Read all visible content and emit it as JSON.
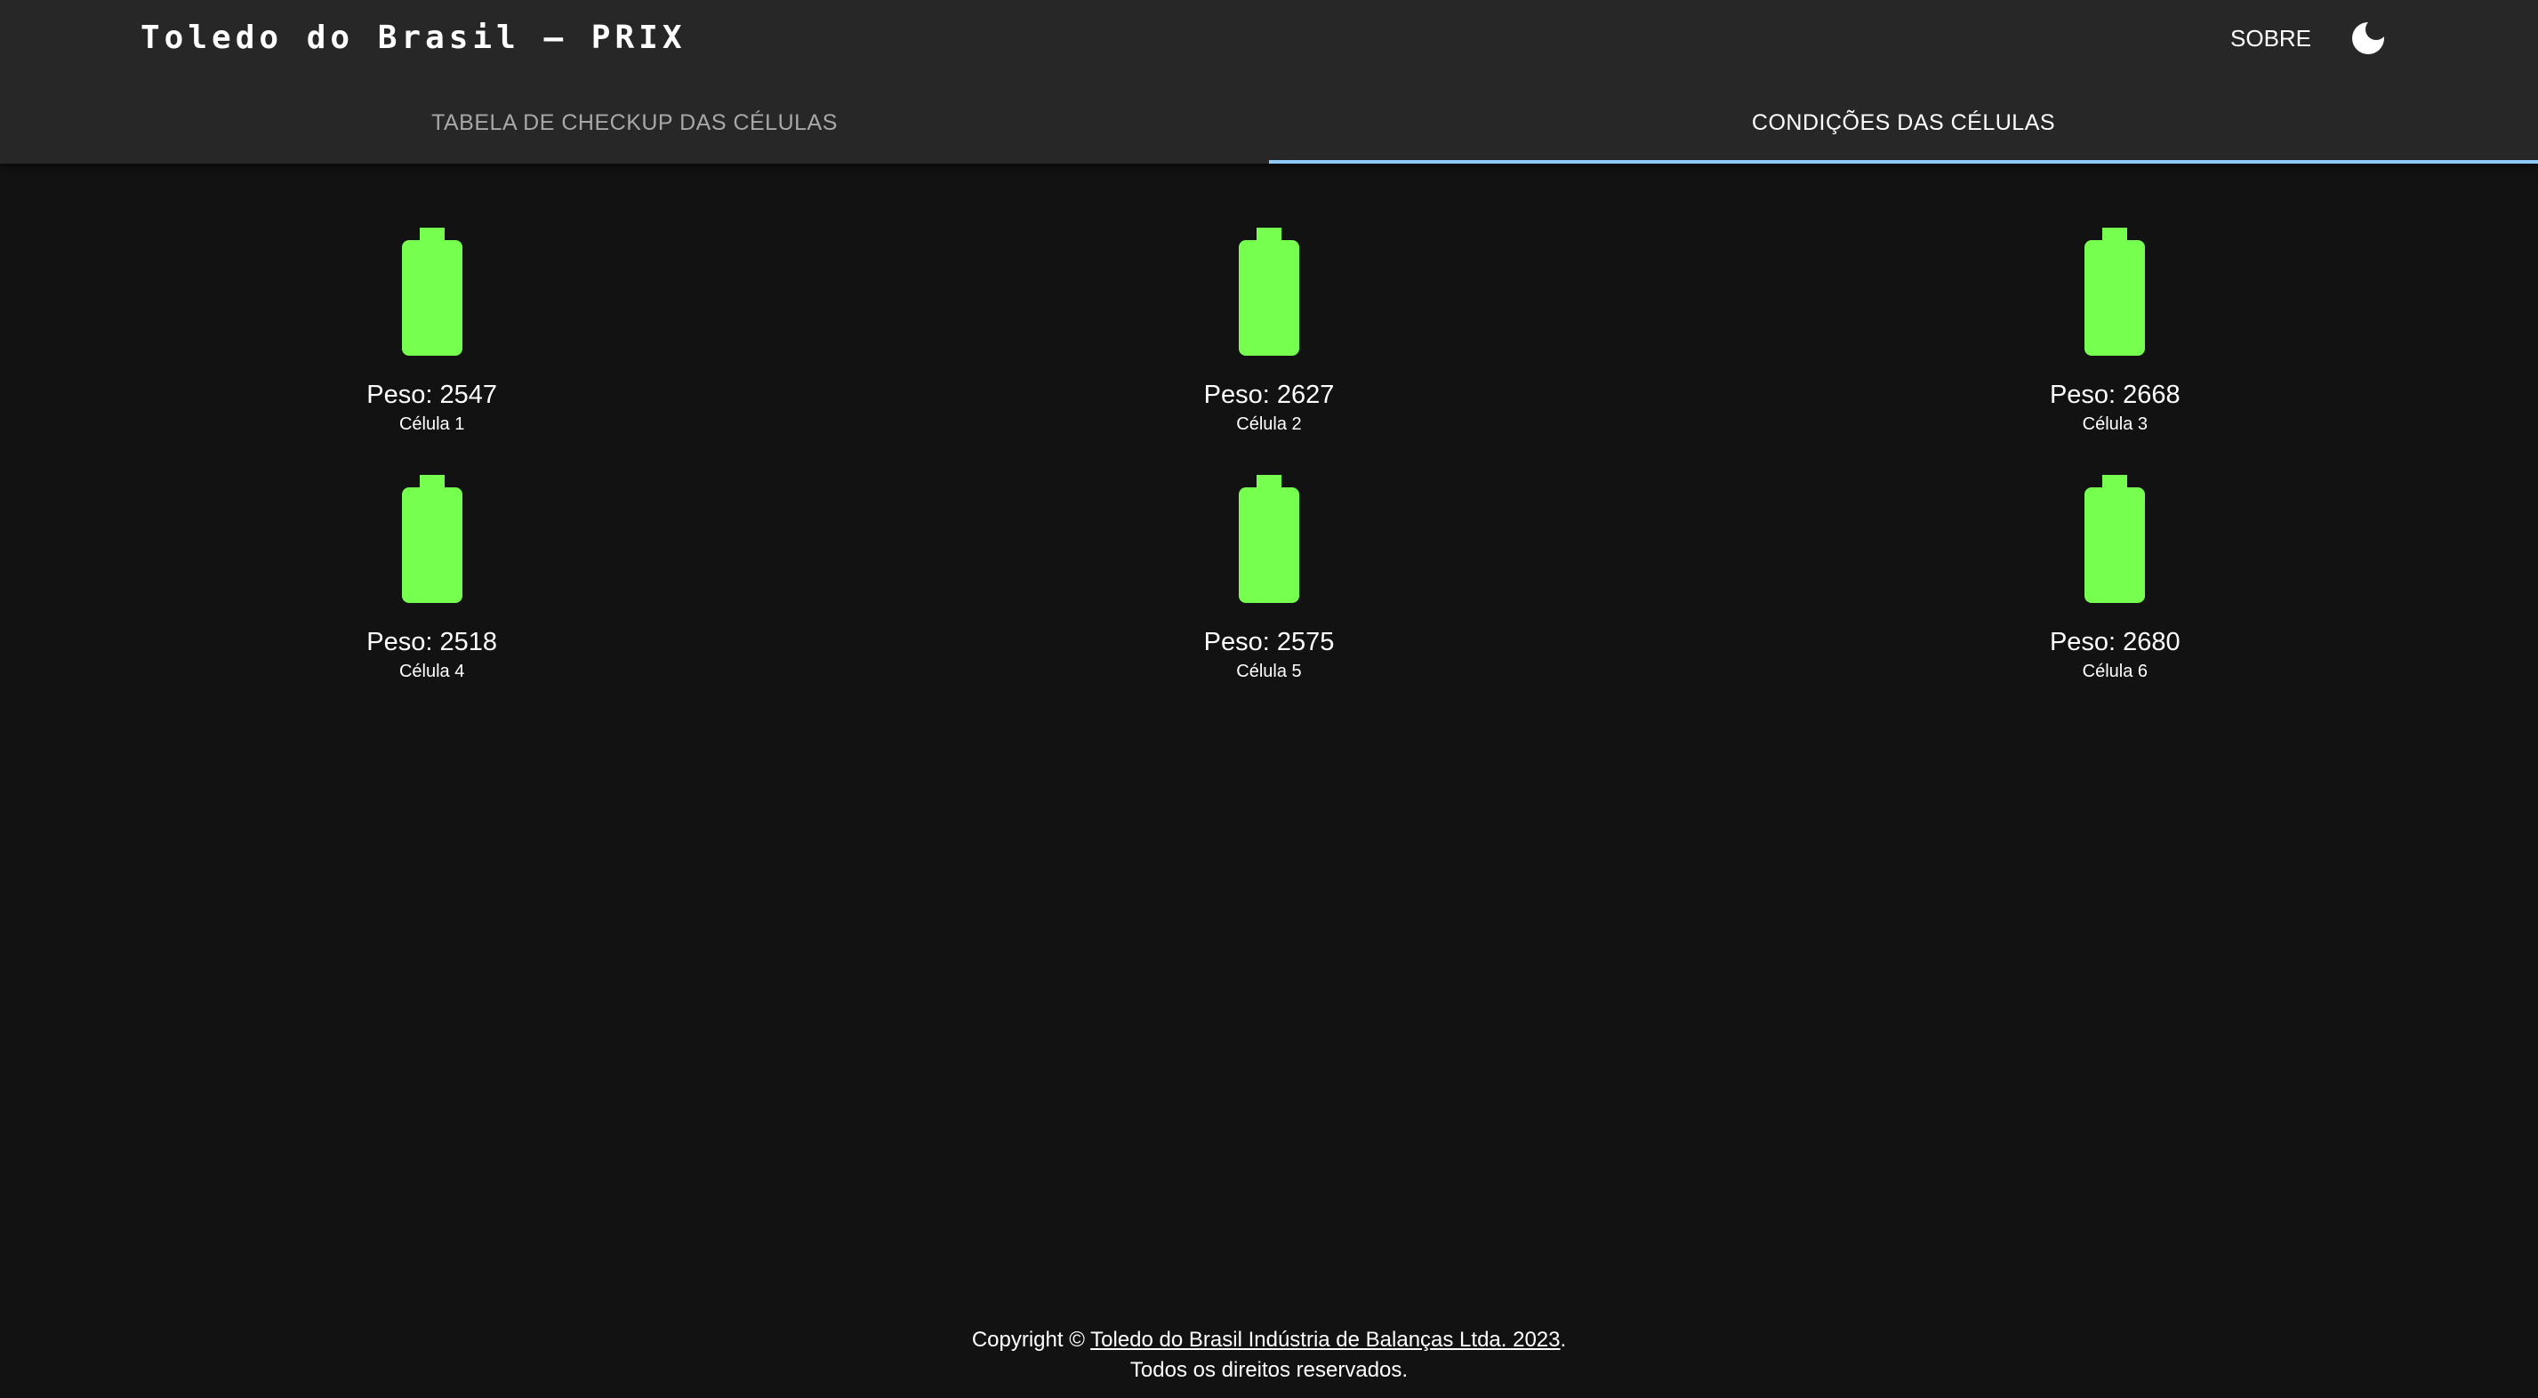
{
  "header": {
    "title": "Toledo do Brasil – PRIX",
    "about_label": "SOBRE",
    "theme_icon": "moon-icon"
  },
  "tabs": [
    {
      "label": "TABELA DE CHECKUP DAS CÉLULAS",
      "active": false
    },
    {
      "label": "CONDIÇÕES DAS CÉLULAS",
      "active": true
    }
  ],
  "cells": [
    {
      "peso": "Peso: 2547",
      "label": "Célula 1",
      "icon": "battery-full-icon"
    },
    {
      "peso": "Peso: 2627",
      "label": "Célula 2",
      "icon": "battery-full-icon"
    },
    {
      "peso": "Peso: 2668",
      "label": "Célula 3",
      "icon": "battery-full-icon"
    },
    {
      "peso": "Peso: 2518",
      "label": "Célula 4",
      "icon": "battery-full-icon"
    },
    {
      "peso": "Peso: 2575",
      "label": "Célula 5",
      "icon": "battery-full-icon"
    },
    {
      "peso": "Peso: 2680",
      "label": "Célula 6",
      "icon": "battery-full-icon"
    }
  ],
  "footer": {
    "prefix": "Copyright © ",
    "link_text": "Toledo do Brasil Indústria de Balanças Ltda. 2023",
    "suffix": ".",
    "line2": "Todos os direitos reservados."
  },
  "colors": {
    "background": "#121212",
    "appbar": "#272727",
    "tab_indicator": "#90caf9",
    "battery_ok": "#76ff4f"
  }
}
